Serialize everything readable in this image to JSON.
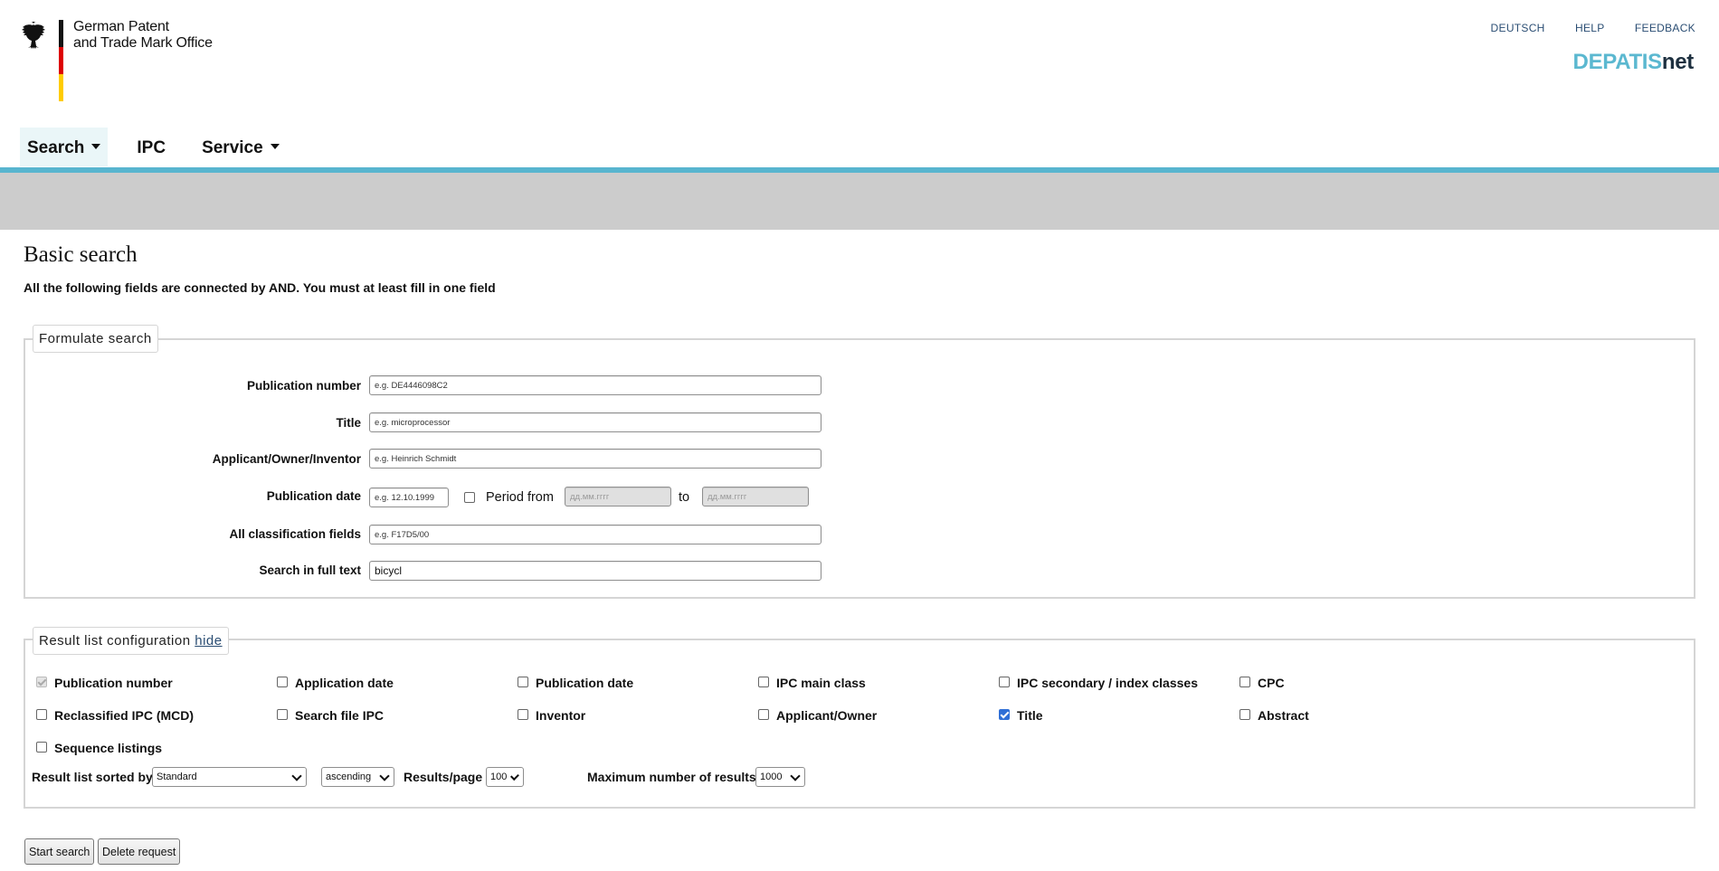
{
  "header": {
    "office_name": "German Patent\nand Trade Mark Office",
    "links": [
      "DEUTSCH",
      "HELP",
      "FEEDBACK"
    ],
    "brand_part1": "DEPATIS",
    "brand_part2": "net",
    "brand_color": "#5bb8d0",
    "flag_colors": [
      "#111111",
      "#dd0000",
      "#ffcc00"
    ]
  },
  "nav": {
    "items": [
      {
        "label": "Search",
        "dropdown": true,
        "active": true
      },
      {
        "label": "IPC",
        "dropdown": false,
        "active": false
      },
      {
        "label": "Service",
        "dropdown": true,
        "active": false
      }
    ],
    "bar_color": "#58b5cf"
  },
  "page": {
    "title": "Basic search",
    "intro": "All the following fields are connected by AND. You must at least fill in one field"
  },
  "formulate": {
    "legend": "Formulate search",
    "publication_number": {
      "label": "Publication number",
      "placeholder": "e.g. DE4446098C2",
      "value": ""
    },
    "title": {
      "label": "Title",
      "placeholder": "e.g. microprocessor",
      "value": ""
    },
    "applicant": {
      "label": "Applicant/Owner/Inventor",
      "placeholder": "e.g. Heinrich Schmidt",
      "value": ""
    },
    "publication_date": {
      "label": "Publication date",
      "placeholder": "e.g. 12.10.1999",
      "period_label": "Period from",
      "from_placeholder": "дд.мм.гггг",
      "to_label": "to",
      "to_placeholder": "дд.мм.гггг",
      "period_checked": false
    },
    "classification": {
      "label": "All classification fields",
      "placeholder": "e.g. F17D5/00",
      "value": ""
    },
    "fulltext": {
      "label": "Search in full text",
      "value": "bicycl"
    }
  },
  "result_config": {
    "legend": "Result list configuration",
    "hide_link": "hide",
    "checkboxes": [
      {
        "label": "Publication number",
        "checked": true,
        "disabled": true
      },
      {
        "label": "Application date",
        "checked": false
      },
      {
        "label": "Publication date",
        "checked": false
      },
      {
        "label": "IPC main class",
        "checked": false
      },
      {
        "label": "IPC secondary / index classes",
        "checked": false
      },
      {
        "label": "CPC",
        "checked": false
      },
      {
        "label": "Reclassified IPC (MCD)",
        "checked": false
      },
      {
        "label": "Search file IPC",
        "checked": false
      },
      {
        "label": "Inventor",
        "checked": false
      },
      {
        "label": "Applicant/Owner",
        "checked": false
      },
      {
        "label": "Title",
        "checked": true
      },
      {
        "label": "Abstract",
        "checked": false
      },
      {
        "label": "Sequence listings",
        "checked": false
      }
    ],
    "sorted_by_label": "Result list sorted by",
    "sorted_by_value": "Standard",
    "order_value": "ascending",
    "results_page_label": "Results/page",
    "results_page_value": "100",
    "max_results_label": "Maximum number of results",
    "max_results_value": "1000"
  },
  "buttons": {
    "start": "Start search",
    "delete": "Delete request"
  }
}
